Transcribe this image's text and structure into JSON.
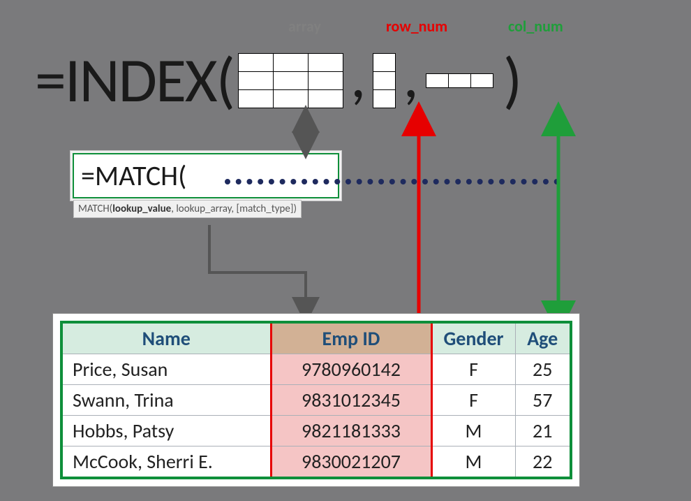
{
  "labels": {
    "array": "array",
    "row_num": "row_num",
    "col_num": "col_num"
  },
  "formula": {
    "index": "=INDEX(",
    "close": ")",
    "comma": ","
  },
  "match": {
    "text": "=MATCH(",
    "tooltip_prefix": "MATCH(",
    "tooltip_bold": "lookup_value",
    "tooltip_rest": ", lookup_array, [match_type])"
  },
  "table": {
    "headers": {
      "name": "Name",
      "emp_id": "Emp ID",
      "gender": "Gender",
      "age": "Age"
    },
    "rows": [
      {
        "name": "Price, Susan",
        "emp_id": "9780960142",
        "gender": "F",
        "age": "25"
      },
      {
        "name": "Swann, Trina",
        "emp_id": "9831012345",
        "gender": "F",
        "age": "57"
      },
      {
        "name": "Hobbs, Patsy",
        "emp_id": "9821181333",
        "gender": "M",
        "age": "21"
      },
      {
        "name": "McCook, Sherri E.",
        "emp_id": "9830021207",
        "gender": "M",
        "age": "22"
      }
    ]
  }
}
